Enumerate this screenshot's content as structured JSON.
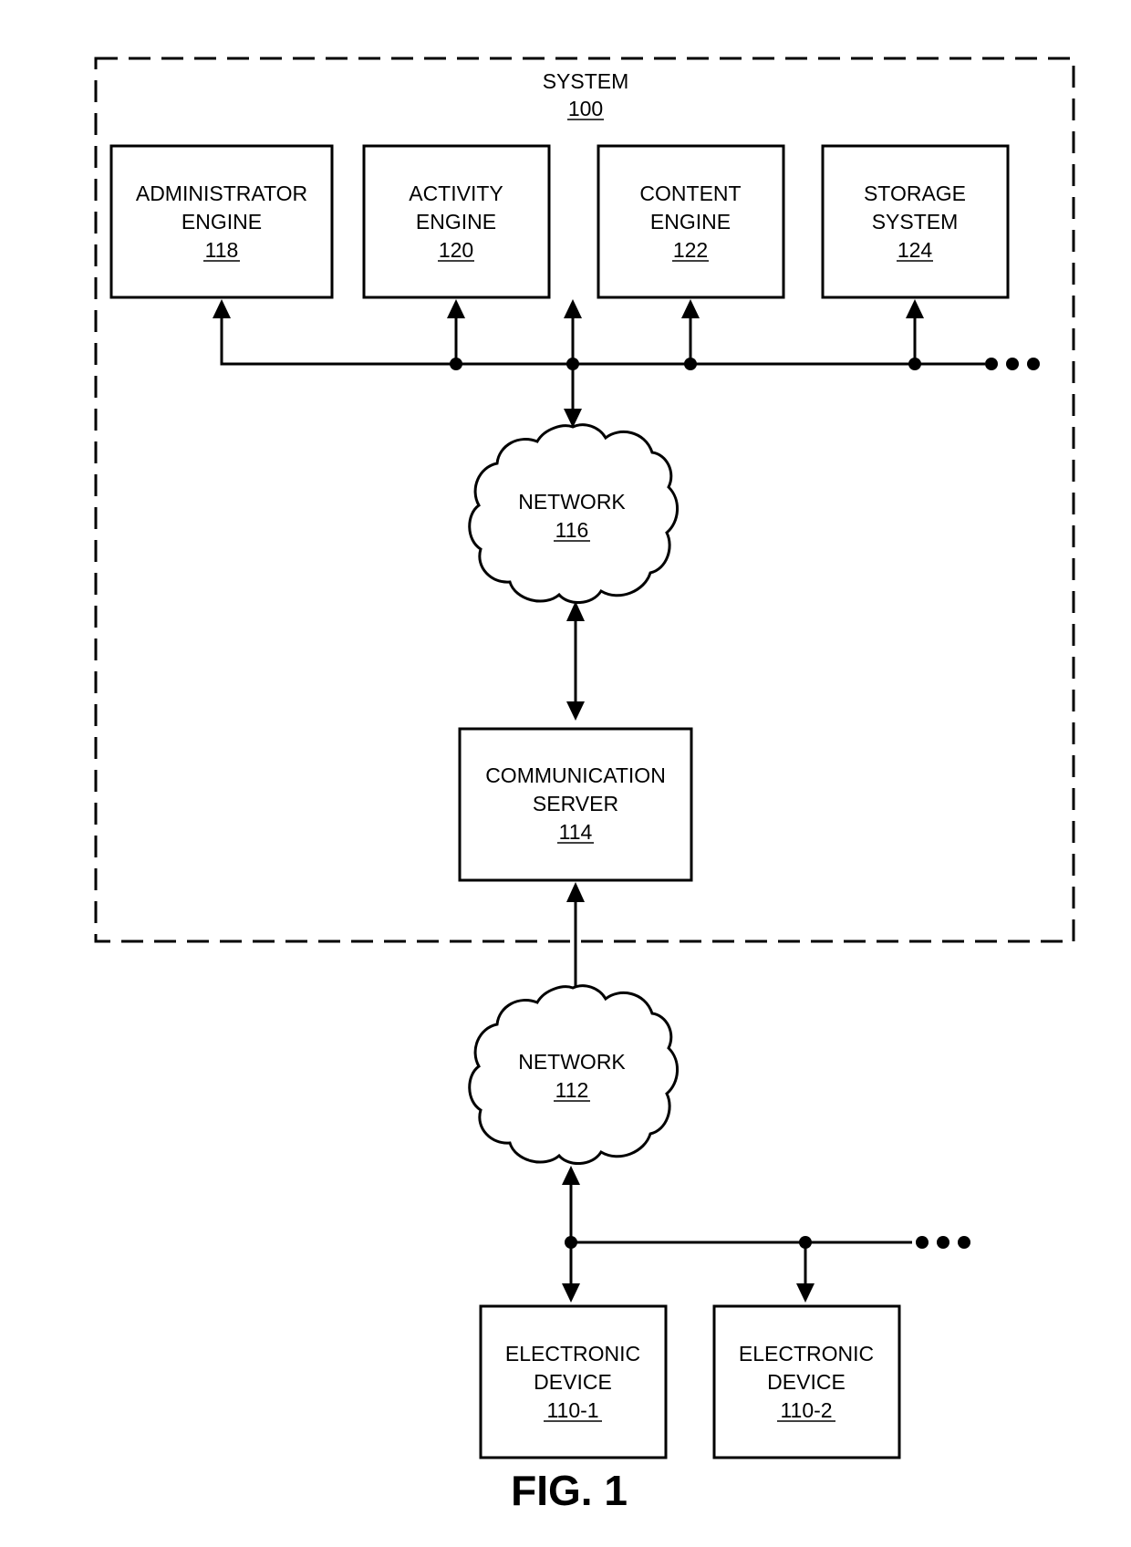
{
  "figure": {
    "caption": "FIG. 1",
    "system": {
      "name": "SYSTEM",
      "ref": "100"
    },
    "components": [
      {
        "id": "administrator-engine",
        "lines": [
          "ADMINISTRATOR",
          "ENGINE"
        ],
        "ref": "118"
      },
      {
        "id": "activity-engine",
        "lines": [
          "ACTIVITY",
          "ENGINE"
        ],
        "ref": "120"
      },
      {
        "id": "content-engine",
        "lines": [
          "CONTENT",
          "ENGINE"
        ],
        "ref": "122"
      },
      {
        "id": "storage-system",
        "lines": [
          "STORAGE",
          "SYSTEM"
        ],
        "ref": "124"
      }
    ],
    "internal_network": {
      "name": "NETWORK",
      "ref": "116"
    },
    "communication_server": {
      "lines": [
        "COMMUNICATION",
        "SERVER"
      ],
      "ref": "114"
    },
    "external_network": {
      "name": "NETWORK",
      "ref": "112"
    },
    "devices": [
      {
        "id": "electronic-device-1",
        "lines": [
          "ELECTRONIC",
          "DEVICE"
        ],
        "ref": "110-1"
      },
      {
        "id": "electronic-device-2",
        "lines": [
          "ELECTRONIC",
          "DEVICE"
        ],
        "ref": "110-2"
      }
    ],
    "continuation_marker": "ellipsis"
  }
}
